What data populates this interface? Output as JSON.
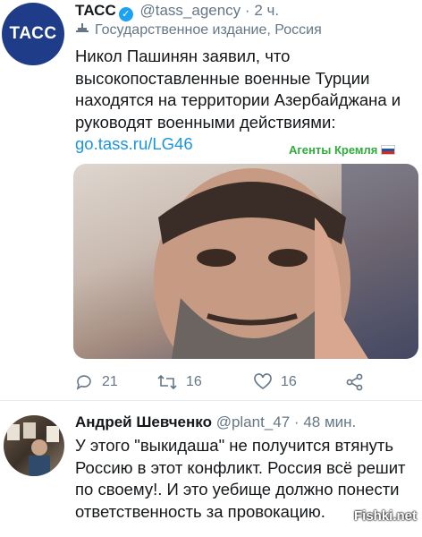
{
  "tweet": {
    "avatar_text": "ТАСС",
    "name": "ТАСС",
    "handle": "@tass_agency",
    "separator": "·",
    "time": "2 ч.",
    "label": "Государственное издание, Россия",
    "text": "Никол Пашинян заявил, что высокопоставленные военные Турции находятся на территории Азербайджана и руководят военными действиями:",
    "link": "go.tass.ru/LG46",
    "watermark": "Агенты Кремля",
    "actions": {
      "replies": "21",
      "retweets": "16",
      "likes": "16"
    }
  },
  "reply": {
    "name": "Андрей Шевченко",
    "handle": "@plant_47",
    "separator": "·",
    "time": "48 мин.",
    "text": "У этого \"выкидаша\" не получится втянуть Россию в этот конфликт. Россия всё решит по своему!. И это уебище должно понести ответственность за провокацию."
  },
  "site_watermark": "Fishki.net",
  "colors": {
    "link": "#1b95e0",
    "muted": "#657786",
    "verified": "#1da1f2",
    "watermark": "#2eac3c",
    "tass_brand": "#1f3c88"
  }
}
